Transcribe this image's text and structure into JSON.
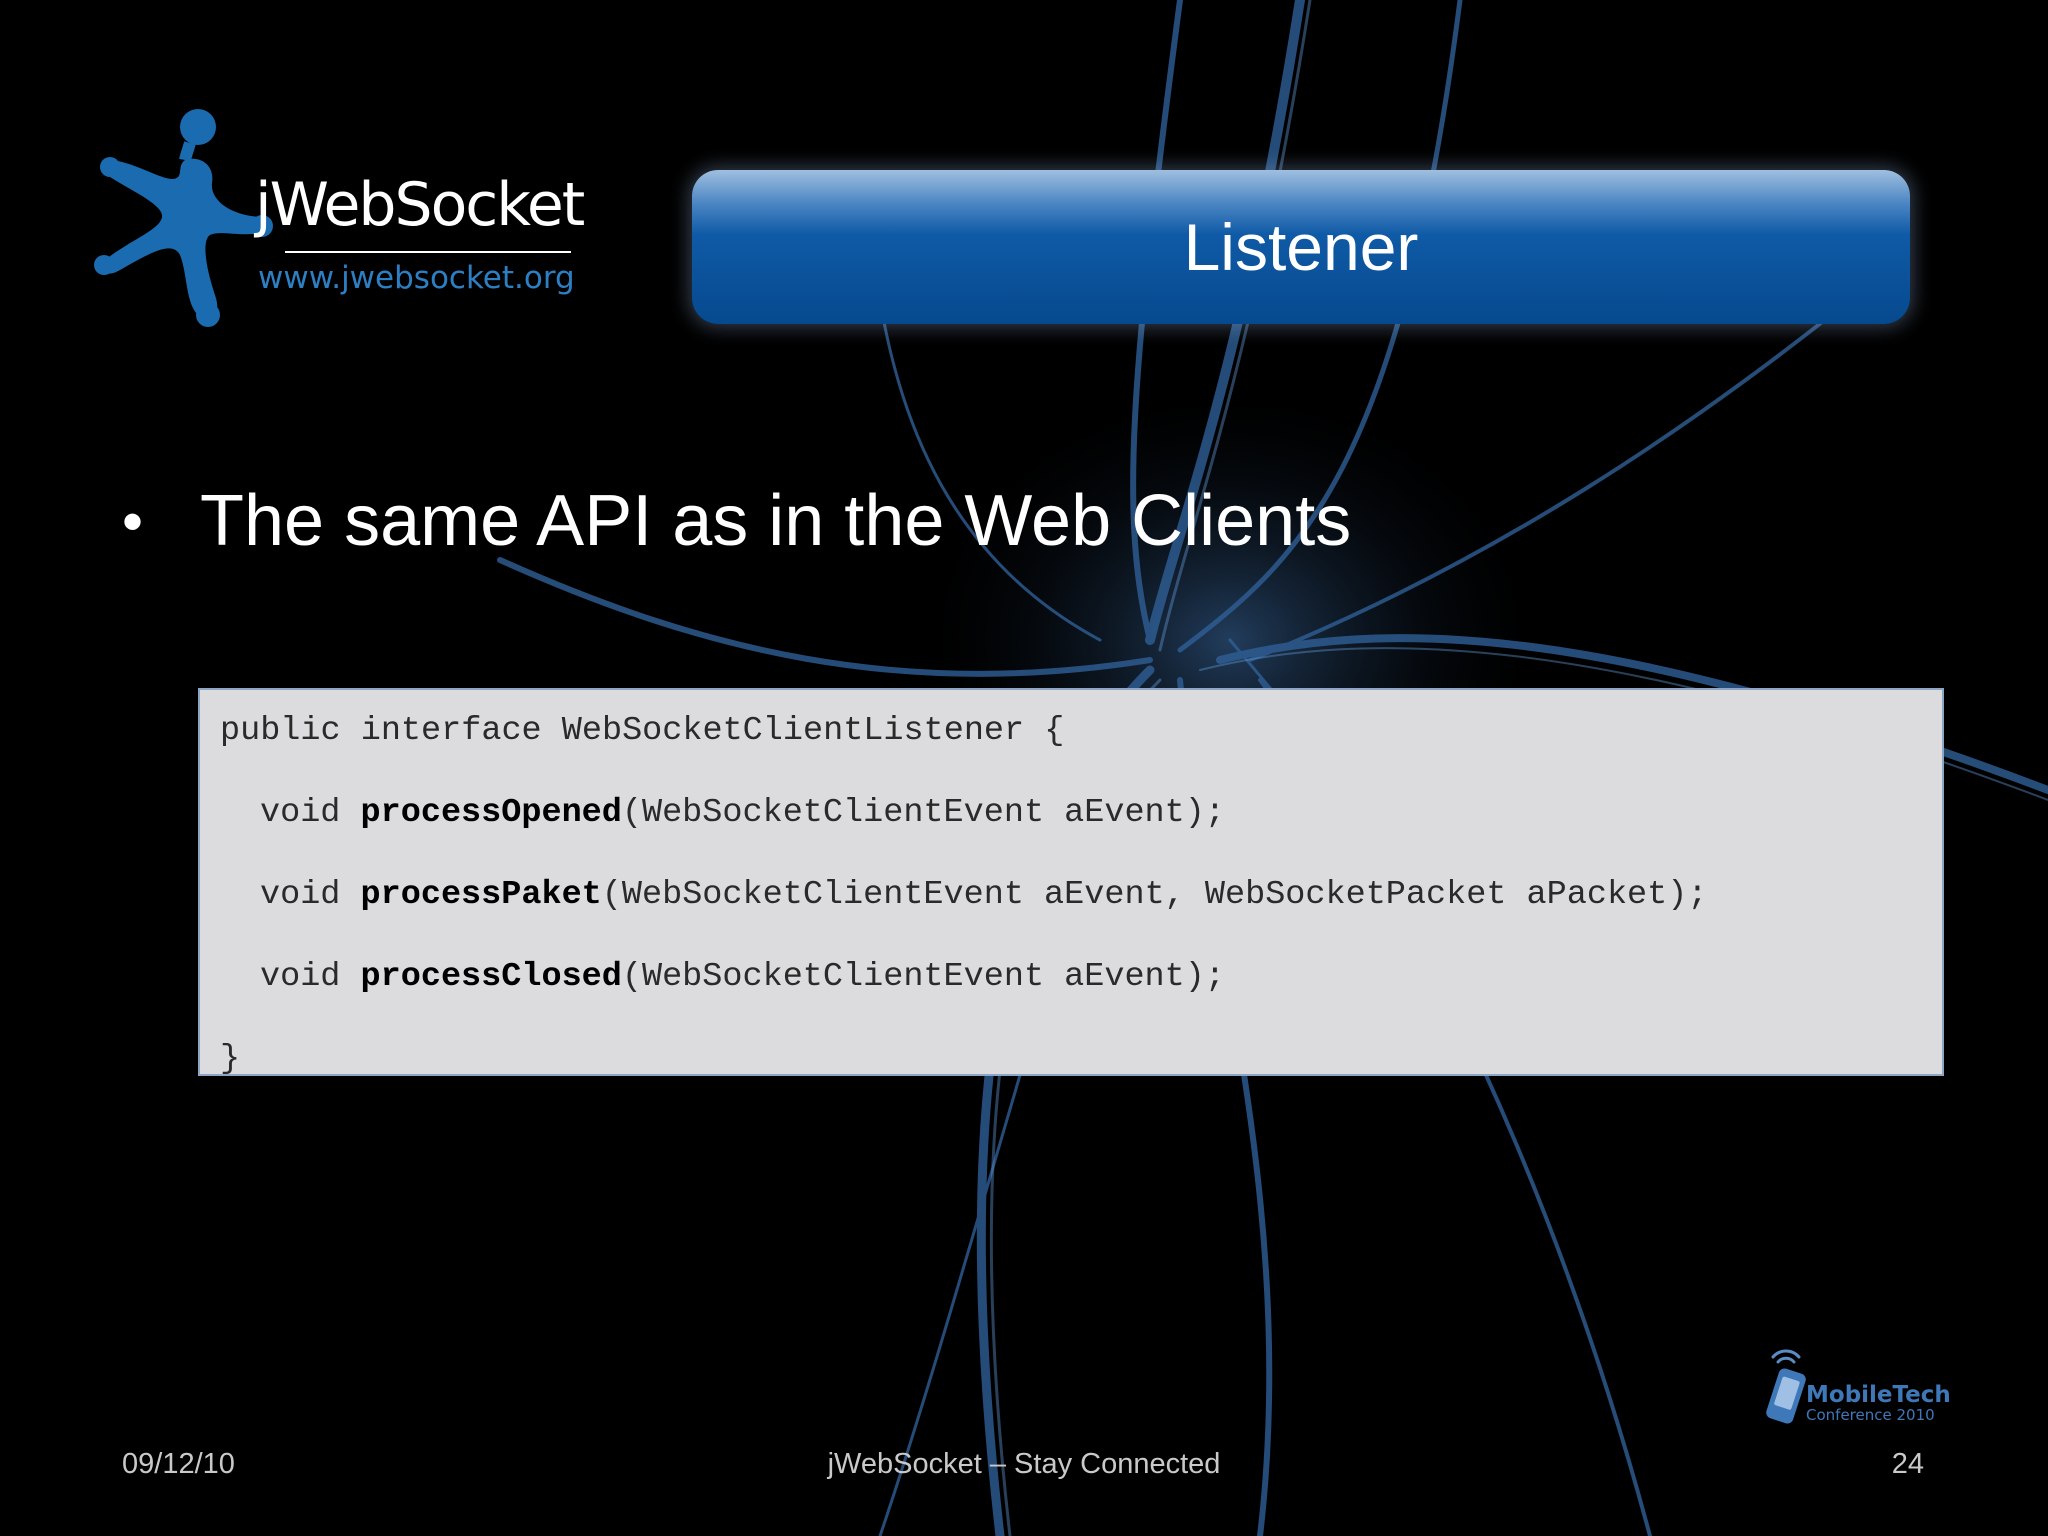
{
  "logo": {
    "name": "jWebSocket",
    "url": "www.jwebsocket.org"
  },
  "title": "Listener",
  "bullet": "The same API as in the Web Clients",
  "code": {
    "line1": "public interface WebSocketClientListener {",
    "line2": {
      "kw": "void ",
      "fn": "processOpened",
      "args": "(WebSocketClientEvent aEvent);"
    },
    "line3": {
      "kw": "void ",
      "fn": "processPaket",
      "args": "(WebSocketClientEvent aEvent, WebSocketPacket aPacket);"
    },
    "line4": {
      "kw": "void ",
      "fn": "processClosed",
      "args": "(WebSocketClientEvent aEvent);"
    },
    "line5": "}"
  },
  "footer": {
    "date": "09/12/10",
    "center": "jWebSocket – Stay Connected",
    "page": "24"
  },
  "conference": {
    "name": "MobileTech",
    "sub": "Conference 2010"
  },
  "colors": {
    "title_bar": "#06498e",
    "logo_blue": "#1a6bb0",
    "code_bg": "#dcdcdf"
  },
  "icons": {
    "logo_figure": "starfish-person-icon",
    "conference": "phone-signal-icon"
  }
}
